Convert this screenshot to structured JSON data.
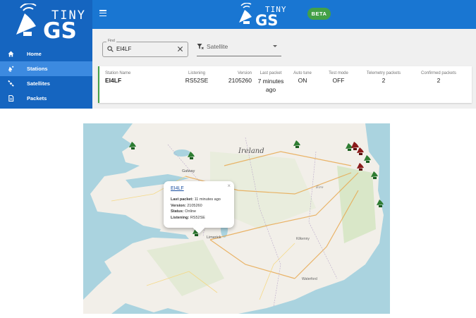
{
  "app": {
    "logo_top": "TINY",
    "logo_bottom": "GS",
    "beta": "BETA"
  },
  "sidebar": {
    "items": [
      {
        "label": "Home",
        "icon": "home-icon"
      },
      {
        "label": "Stations",
        "icon": "satellite-dish-icon"
      },
      {
        "label": "Satellites",
        "icon": "satellite-icon"
      },
      {
        "label": "Packets",
        "icon": "document-icon"
      }
    ],
    "active_index": 1
  },
  "filters": {
    "find_label": "Find",
    "find_value": "EI4LF",
    "satellite_placeholder": "Satellite"
  },
  "station": {
    "columns": [
      {
        "label": "Station Name",
        "value": "EI4LF"
      },
      {
        "label": "Listening",
        "value": "RS52SE"
      },
      {
        "label": "Version",
        "value": "2105260"
      },
      {
        "label": "Last packet",
        "value": "7 minutes ago"
      },
      {
        "label": "Auto tune",
        "value": "ON"
      },
      {
        "label": "Test mode",
        "value": "OFF"
      },
      {
        "label": "Telemetry packets",
        "value": "2"
      },
      {
        "label": "Confirmed packets",
        "value": "2"
      }
    ],
    "status_color": "#43a047"
  },
  "map": {
    "labels": [
      "Ireland",
      "Galway",
      "Limerick",
      "Kilkenny",
      "Waterford",
      "Éire"
    ],
    "popup": {
      "title": "EI4LF",
      "last_packet_label": "Last packet:",
      "last_packet": "11 minutes ago",
      "version_label": "Version:",
      "version": "2105260",
      "status_label": "Status:",
      "status": "Online",
      "listening_label": "Listening:",
      "listening": "RS52SE"
    }
  },
  "colors": {
    "sidebar": "#1565c0",
    "topbar": "#1976d2",
    "beta": "#43a047",
    "online": "#2e7d32",
    "offline": "#8b1a1a"
  }
}
